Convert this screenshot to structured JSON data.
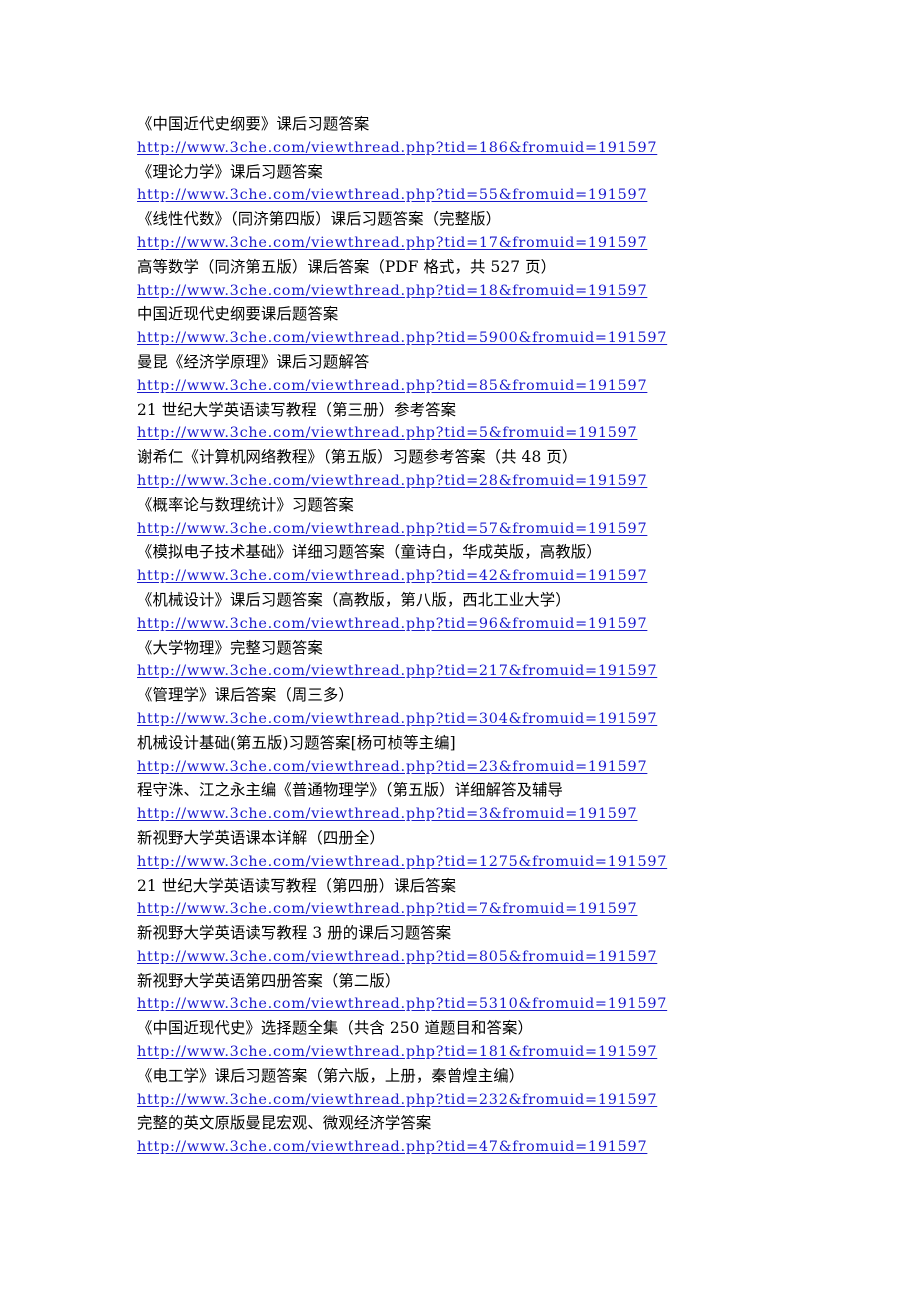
{
  "document": {
    "background_color": "#ffffff",
    "text_color": "#000000",
    "link_color": "#1a1acc",
    "entries": [
      {
        "title": "《中国近代史纲要》课后习题答案",
        "url": "http://www.3che.com/viewthread.php?tid=186&fromuid=191597"
      },
      {
        "title": "《理论力学》课后习题答案",
        "url": "http://www.3che.com/viewthread.php?tid=55&fromuid=191597"
      },
      {
        "title": "《线性代数》（同济第四版）课后习题答案（完整版）",
        "url": "http://www.3che.com/viewthread.php?tid=17&fromuid=191597"
      },
      {
        "title": "高等数学（同济第五版）课后答案（PDF 格式，共 527 页）",
        "url": "http://www.3che.com/viewthread.php?tid=18&fromuid=191597"
      },
      {
        "title": "中国近现代史纲要课后题答案",
        "url": "http://www.3che.com/viewthread.php?tid=5900&fromuid=191597"
      },
      {
        "title": "曼昆《经济学原理》课后习题解答",
        "url": "http://www.3che.com/viewthread.php?tid=85&fromuid=191597"
      },
      {
        "title": "21 世纪大学英语读写教程（第三册）参考答案",
        "url": "http://www.3che.com/viewthread.php?tid=5&fromuid=191597"
      },
      {
        "title": "谢希仁《计算机网络教程》（第五版）习题参考答案（共 48 页）",
        "url": "http://www.3che.com/viewthread.php?tid=28&fromuid=191597"
      },
      {
        "title": "《概率论与数理统计》习题答案",
        "url": "http://www.3che.com/viewthread.php?tid=57&fromuid=191597"
      },
      {
        "title": "《模拟电子技术基础》详细习题答案（童诗白，华成英版，高教版）",
        "url": "http://www.3che.com/viewthread.php?tid=42&fromuid=191597"
      },
      {
        "title": "《机械设计》课后习题答案（高教版，第八版，西北工业大学）",
        "url": "http://www.3che.com/viewthread.php?tid=96&fromuid=191597"
      },
      {
        "title": "《大学物理》完整习题答案",
        "url": "http://www.3che.com/viewthread.php?tid=217&fromuid=191597"
      },
      {
        "title": "《管理学》课后答案（周三多）",
        "url": "http://www.3che.com/viewthread.php?tid=304&fromuid=191597"
      },
      {
        "title": "机械设计基础(第五版)习题答案[杨可桢等主编]",
        "url": "http://www.3che.com/viewthread.php?tid=23&fromuid=191597"
      },
      {
        "title": "程守洙、江之永主编《普通物理学》（第五版）详细解答及辅导",
        "url": "http://www.3che.com/viewthread.php?tid=3&fromuid=191597"
      },
      {
        "title": "新视野大学英语课本详解（四册全）",
        "url": "http://www.3che.com/viewthread.php?tid=1275&fromuid=191597"
      },
      {
        "title": "21 世纪大学英语读写教程（第四册）课后答案",
        "url": "http://www.3che.com/viewthread.php?tid=7&fromuid=191597"
      },
      {
        "title": "新视野大学英语读写教程 3 册的课后习题答案",
        "url": "http://www.3che.com/viewthread.php?tid=805&fromuid=191597"
      },
      {
        "title": "新视野大学英语第四册答案（第二版）",
        "url": "http://www.3che.com/viewthread.php?tid=5310&fromuid=191597"
      },
      {
        "title": "《中国近现代史》选择题全集（共含 250 道题目和答案）",
        "url": "http://www.3che.com/viewthread.php?tid=181&fromuid=191597"
      },
      {
        "title": "《电工学》课后习题答案（第六版，上册，秦曾煌主编）",
        "url": "http://www.3che.com/viewthread.php?tid=232&fromuid=191597"
      },
      {
        "title": "完整的英文原版曼昆宏观、微观经济学答案",
        "url": "http://www.3che.com/viewthread.php?tid=47&fromuid=191597"
      }
    ]
  }
}
